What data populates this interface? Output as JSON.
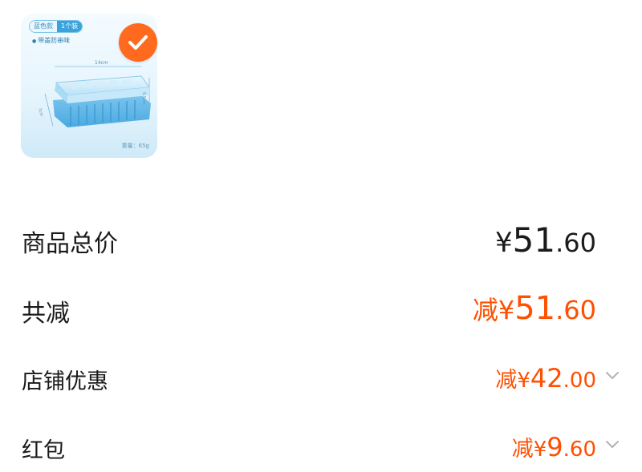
{
  "product": {
    "image_tag_color": "蓝色款",
    "image_tag_count": "1个装",
    "image_subtext": "带盖防串味",
    "image_dimension_length": "14cm",
    "image_dimension_height": "5.5cm",
    "image_dimension_width": "7cm",
    "image_weight": "重量：65g",
    "selected": true
  },
  "summary": {
    "total": {
      "label": "商品总价",
      "currency": "¥",
      "integer": "51",
      "decimal": ".60"
    },
    "discount_total": {
      "label": "共减",
      "prefix": "减",
      "currency": "¥",
      "integer": "51",
      "decimal": ".60"
    },
    "shop_discount": {
      "label": "店铺优惠",
      "prefix": "减",
      "currency": "¥",
      "integer": "42",
      "decimal": ".00"
    },
    "red_packet": {
      "label": "红包",
      "prefix": "减",
      "currency": "¥",
      "integer": "9",
      "decimal": ".60"
    }
  },
  "colors": {
    "accent": "#ff4f00",
    "check_badge": "#ff6a1f",
    "text": "#1a1a1a",
    "chevron": "#b3b3b3"
  },
  "icons": {
    "selected": "checkmark-icon",
    "expand": "chevron-down-icon"
  }
}
